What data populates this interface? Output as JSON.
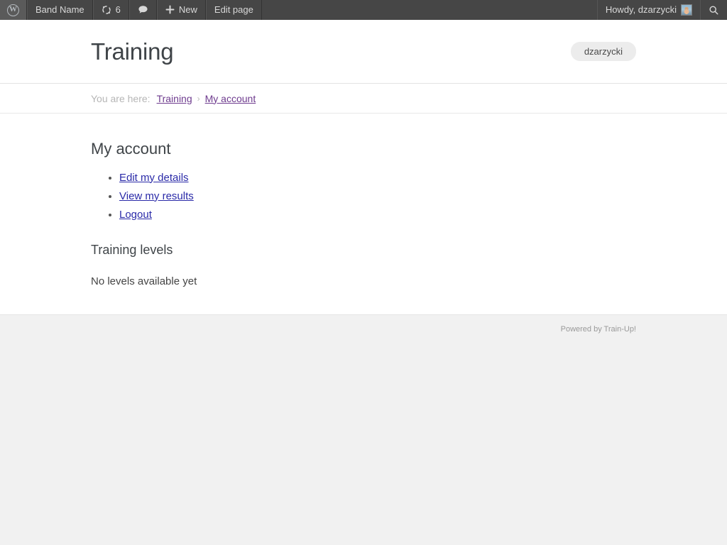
{
  "adminbar": {
    "wp_logo_letter": "W",
    "left_items": [
      {
        "name": "site-name",
        "label": "Band Name"
      },
      {
        "name": "updates",
        "label": "6"
      },
      {
        "name": "comments",
        "label": ""
      },
      {
        "name": "new-content",
        "label": "New"
      },
      {
        "name": "edit-page",
        "label": "Edit page"
      }
    ],
    "site_name": "Band Name",
    "updates_count": "6",
    "new_label": "New",
    "edit_page_label": "Edit page",
    "howdy": "Howdy, dzarzycki",
    "search_icon": "search-icon",
    "colors": {
      "bar_bg": "#464646",
      "bar_text": "#d8d8d8"
    }
  },
  "header": {
    "title": "Training",
    "user_pill": "dzarzycki"
  },
  "breadcrumb": {
    "label": "You are here:",
    "separator": "›",
    "items": [
      {
        "label": "Training"
      },
      {
        "label": "My account"
      }
    ]
  },
  "main": {
    "heading": "My account",
    "links": [
      {
        "label": "Edit my details"
      },
      {
        "label": "View my results"
      },
      {
        "label": "Logout"
      }
    ],
    "section_heading": "Training levels",
    "empty_message": "No levels available yet"
  },
  "footer": {
    "credit": "Powered by Train-Up!"
  },
  "colors": {
    "link_blue": "#2a2aa8",
    "link_visited_purple": "#6e3b8e",
    "page_bg": "#f1f1f1",
    "content_bg": "#ffffff"
  }
}
